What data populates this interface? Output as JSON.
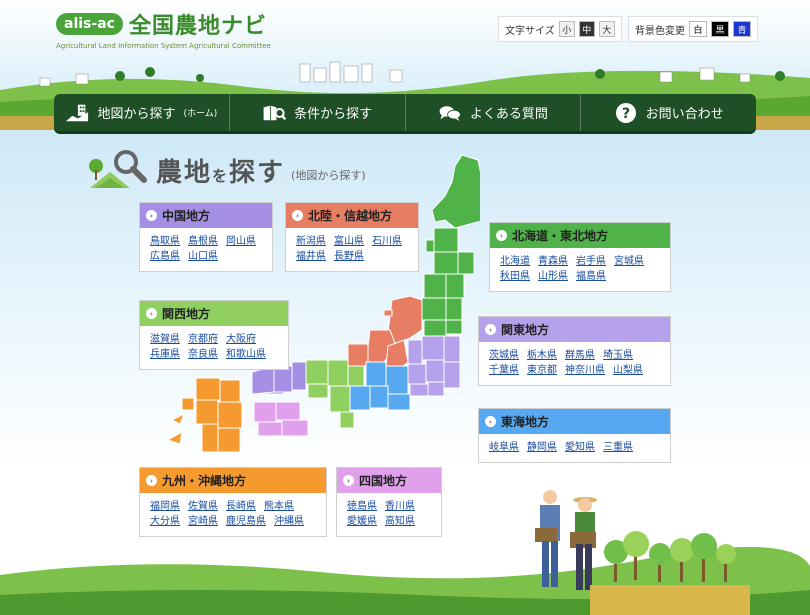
{
  "site": {
    "logo_badge": "alis-ac",
    "logo_title": "全国農地ナビ",
    "logo_subtitle": "Agricultural Land Information System Agricultural Committee"
  },
  "font_size": {
    "label": "文字サイズ",
    "options": [
      "小",
      "中",
      "大"
    ],
    "selected": "中"
  },
  "bg_color": {
    "label": "背景色変更",
    "options": [
      "白",
      "黒",
      "青"
    ]
  },
  "nav": {
    "items": [
      {
        "label": "地図から探す",
        "sub": "(ホーム)",
        "icon": "map-building-icon"
      },
      {
        "label": "条件から探す",
        "icon": "book-search-icon"
      },
      {
        "label": "よくある質問",
        "icon": "speech-bubbles-icon"
      },
      {
        "label": "お問い合わせ",
        "icon": "question-circle-icon"
      }
    ]
  },
  "heading": {
    "title_a": "農地",
    "title_b": "を",
    "title_c": "探す",
    "sub": "(地図から探す)"
  },
  "regions": {
    "chugoku": {
      "name": "中国地方",
      "color": "#a48fe4",
      "prefs": [
        "鳥取県",
        "島根県",
        "岡山県",
        "広島県",
        "山口県"
      ]
    },
    "hokuriku": {
      "name": "北陸・信越地方",
      "color": "#e77d62",
      "prefs": [
        "新潟県",
        "富山県",
        "石川県",
        "福井県",
        "長野県"
      ]
    },
    "tohoku": {
      "name": "北海道・東北地方",
      "color": "#4fb34a",
      "prefs": [
        "北海道",
        "青森県",
        "岩手県",
        "宮城県",
        "秋田県",
        "山形県",
        "福島県"
      ]
    },
    "kansai": {
      "name": "関西地方",
      "color": "#8fd061",
      "prefs": [
        "滋賀県",
        "京都府",
        "大阪府",
        "兵庫県",
        "奈良県",
        "和歌山県"
      ]
    },
    "kanto": {
      "name": "関東地方",
      "color": "#b6a2ec",
      "prefs": [
        "茨城県",
        "栃木県",
        "群馬県",
        "埼玉県",
        "千葉県",
        "東京都",
        "神奈川県",
        "山梨県"
      ]
    },
    "tokai": {
      "name": "東海地方",
      "color": "#56a8f0",
      "prefs": [
        "岐阜県",
        "静岡県",
        "愛知県",
        "三重県"
      ]
    },
    "kyushu": {
      "name": "九州・沖縄地方",
      "color": "#f59a2f",
      "prefs": [
        "福岡県",
        "佐賀県",
        "長崎県",
        "熊本県",
        "大分県",
        "宮崎県",
        "鹿児島県",
        "沖縄県"
      ]
    },
    "shikoku": {
      "name": "四国地方",
      "color": "#e0a0ec",
      "prefs": [
        "徳島県",
        "香川県",
        "愛媛県",
        "高知県"
      ]
    }
  }
}
